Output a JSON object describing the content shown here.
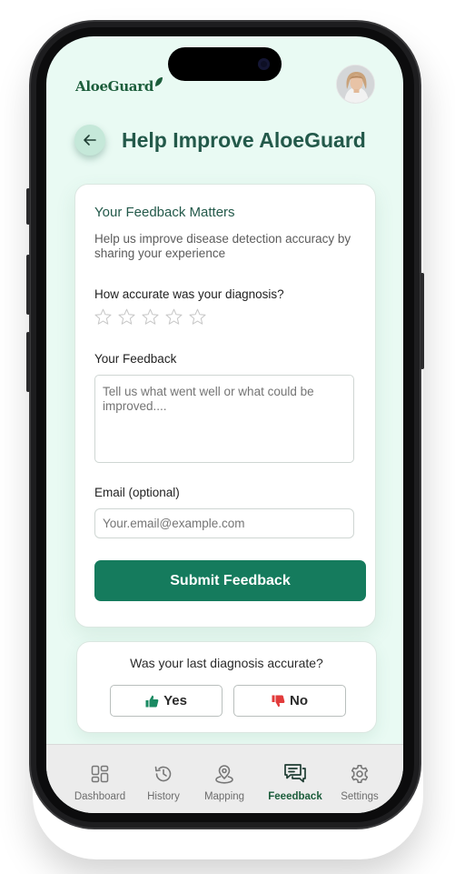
{
  "header": {
    "brand": "AloeGuard",
    "logo_icon": "leaf-icon",
    "avatar_icon": "user-avatar"
  },
  "page": {
    "title": "Help Improve AloeGuard",
    "back_icon": "arrow-left-icon"
  },
  "feedback_card": {
    "title": "Your Feedback Matters",
    "description": "Help us improve disease detection accuracy by sharing your experience",
    "rating_label": "How accurate was your diagnosis?",
    "rating_value": 0,
    "rating_max": 5,
    "feedback_label": "Your Feedback",
    "feedback_placeholder": "Tell us what went well or what could be improved....",
    "email_label": "Email (optional)",
    "email_placeholder": "Your.email@example.com",
    "submit_label": "Submit Feedback"
  },
  "quick_poll": {
    "question": "Was your last diagnosis accurate?",
    "yes_label": "Yes",
    "no_label": "No",
    "yes_icon": "thumbs-up-icon",
    "no_icon": "thumbs-down-icon"
  },
  "bottom_nav": {
    "items": [
      {
        "label": "Dashboard",
        "icon": "dashboard-icon",
        "active": false
      },
      {
        "label": "History",
        "icon": "history-icon",
        "active": false
      },
      {
        "label": "Mapping",
        "icon": "map-pin-icon",
        "active": false
      },
      {
        "label": "Feeedback",
        "icon": "feedback-icon",
        "active": true
      },
      {
        "label": "Settings",
        "icon": "gear-icon",
        "active": false
      }
    ]
  },
  "colors": {
    "primary": "#157b5d",
    "title": "#23594a",
    "background": "#e9faf3",
    "thumbs_up": "#1a8a62",
    "thumbs_down": "#e23b3b"
  }
}
